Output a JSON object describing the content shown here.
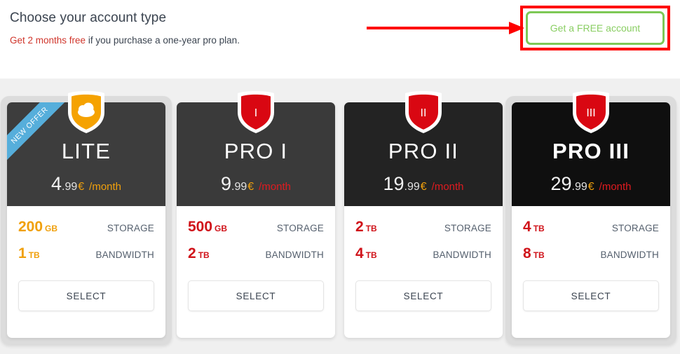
{
  "header": {
    "title": "Choose your account type",
    "subline_highlight": "Get 2 months free",
    "subline_rest": " if you purchase a one-year pro plan.",
    "free_account_button": "Get a FREE account"
  },
  "annotation": {
    "box_color": "#fe0000",
    "arrow_color": "#fe0000"
  },
  "colors": {
    "accent_orange": "#f0a00c",
    "accent_red": "#d0131a",
    "ribbon_blue": "#56aedb",
    "button_green": "#7dc855",
    "page_background": "#f0f0f0"
  },
  "plans": [
    {
      "name": "LITE",
      "badge_kind": "cloud-shield",
      "badge_color": "#f5a201",
      "badge_label": "",
      "header_bg": "#3d3d3d",
      "ribbon": "NEW OFFER",
      "featured": true,
      "price_int": "4",
      "price_dec": ".99",
      "currency": "€",
      "period": "/month",
      "period_color": "#f0a00c",
      "value_color": "#f0a00c",
      "storage_num": "200",
      "storage_unit": "GB",
      "storage_label": "STORAGE",
      "bandwidth_num": "1",
      "bandwidth_unit": "TB",
      "bandwidth_label": "BANDWIDTH",
      "select_label": "SELECT"
    },
    {
      "name": "PRO I",
      "badge_kind": "roman-shield",
      "badge_color": "#d90712",
      "badge_label": "I",
      "header_bg": "#3a3a3a",
      "ribbon": "",
      "featured": false,
      "price_int": "9",
      "price_dec": ".99",
      "currency": "€",
      "period": "/month",
      "period_color": "#e01b20",
      "value_color": "#d0131a",
      "storage_num": "500",
      "storage_unit": "GB",
      "storage_label": "STORAGE",
      "bandwidth_num": "2",
      "bandwidth_unit": "TB",
      "bandwidth_label": "BANDWIDTH",
      "select_label": "SELECT"
    },
    {
      "name": "PRO II",
      "badge_kind": "roman-shield",
      "badge_color": "#d90712",
      "badge_label": "II",
      "header_bg": "#232323",
      "ribbon": "",
      "featured": false,
      "price_int": "19",
      "price_dec": ".99",
      "currency": "€",
      "period": "/month",
      "period_color": "#e01b20",
      "value_color": "#d0131a",
      "storage_num": "2",
      "storage_unit": "TB",
      "storage_label": "STORAGE",
      "bandwidth_num": "4",
      "bandwidth_unit": "TB",
      "bandwidth_label": "BANDWIDTH",
      "select_label": "SELECT"
    },
    {
      "name": "PRO III",
      "badge_kind": "roman-shield",
      "badge_color": "#d90712",
      "badge_label": "III",
      "header_bg": "#0f0f0f",
      "ribbon": "",
      "featured": true,
      "price_int": "29",
      "price_dec": ".99",
      "currency": "€",
      "period": "/month",
      "period_color": "#e01b20",
      "value_color": "#d0131a",
      "storage_num": "4",
      "storage_unit": "TB",
      "storage_label": "STORAGE",
      "bandwidth_num": "8",
      "bandwidth_unit": "TB",
      "bandwidth_label": "BANDWIDTH",
      "select_label": "SELECT"
    }
  ]
}
